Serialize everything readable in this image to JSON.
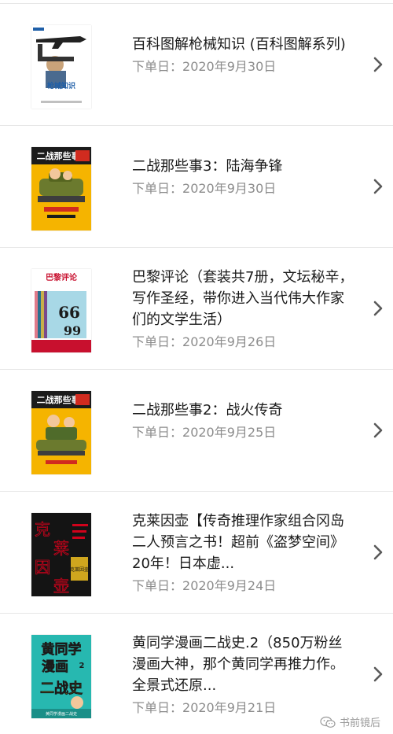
{
  "orders": [
    {
      "title": "百科图解枪械知识 (百科图解系列)",
      "date_label": "下单日：",
      "date": "2020年9月30日",
      "cover": {
        "text": "枪械知识",
        "bg": "#ffffff",
        "accent": "#1f5fa8",
        "icon": "book-cover-firearms"
      }
    },
    {
      "title": "二战那些事3：陆海争锋",
      "date_label": "下单日：",
      "date": "2020年9月30日",
      "cover": {
        "text": "二战那些事3",
        "bg": "#f5b400",
        "accent": "#d12b1f",
        "icon": "book-cover-ww2-3"
      }
    },
    {
      "title": "巴黎评论（套装共7册，文坛秘辛，写作圣经，带你进入当代伟大作家们的文学生活）",
      "date_label": "下单日：",
      "date": "2020年9月26日",
      "cover": {
        "text": "巴黎评论",
        "bg": "#ffffff",
        "accent": "#c8102e",
        "icon": "book-cover-paris-review"
      }
    },
    {
      "title": "二战那些事2：战火传奇",
      "date_label": "下单日：",
      "date": "2020年9月25日",
      "cover": {
        "text": "二战那些事2",
        "bg": "#f5b400",
        "accent": "#d12b1f",
        "icon": "book-cover-ww2-2"
      }
    },
    {
      "title": "克莱因壶【传奇推理作家组合冈岛二人预言之书！超前《盗梦空间》20年！日本虚...",
      "date_label": "下单日：",
      "date": "2020年9月24日",
      "cover": {
        "text": "克莱因壶",
        "bg": "#141414",
        "accent": "#d0021b",
        "icon": "book-cover-klein"
      }
    },
    {
      "title": "黄同学漫画二战史.2（850万粉丝漫画大神，那个黄同学再推力作。全景式还原...",
      "date_label": "下单日：",
      "date": "2020年9月21日",
      "cover": {
        "text": "黄同学漫画二战史",
        "bg": "#27b8b0",
        "accent": "#ffe600",
        "icon": "book-cover-huang"
      }
    }
  ],
  "watermark": {
    "text": "书前镜后",
    "icon": "wechat-icon"
  },
  "colors": {
    "title": "#1a1a1a",
    "date": "#8c8c8c",
    "divider": "#e6e6e6",
    "chevron": "#5a5a5a"
  }
}
